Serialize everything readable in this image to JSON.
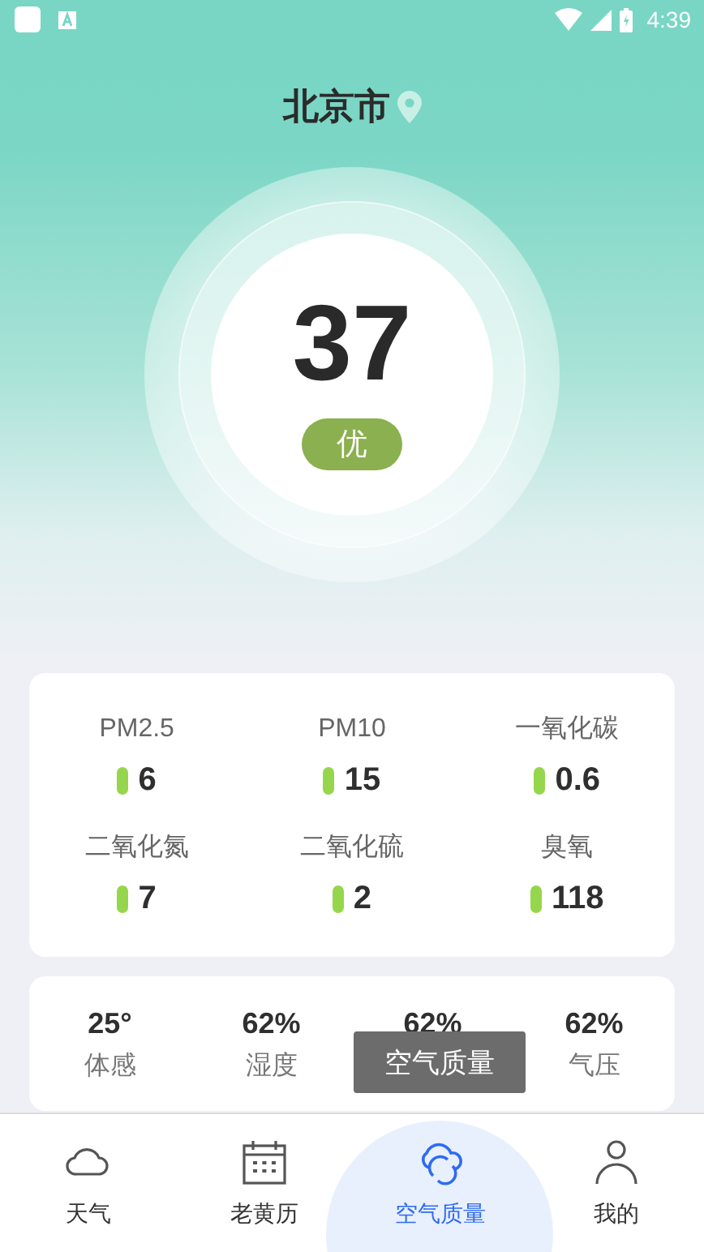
{
  "status_bar": {
    "time": "4:39"
  },
  "city": "北京市",
  "aqi": {
    "value": "37",
    "grade": "优"
  },
  "pollutants": [
    {
      "name": "PM2.5",
      "value": "6"
    },
    {
      "name": "PM10",
      "value": "15"
    },
    {
      "name": "一氧化碳",
      "value": "0.6"
    },
    {
      "name": "二氧化氮",
      "value": "7"
    },
    {
      "name": "二氧化硫",
      "value": "2"
    },
    {
      "name": "臭氧",
      "value": "118"
    }
  ],
  "weather_stats": [
    {
      "value": "25°",
      "label": "体感"
    },
    {
      "value": "62%",
      "label": "湿度"
    },
    {
      "value": "62%"
    },
    {
      "value": "62%",
      "label": "气压"
    }
  ],
  "toast": "空气质量",
  "nav": [
    {
      "kind": "cloud",
      "label": "天气",
      "selected": false
    },
    {
      "kind": "calendar",
      "label": "老黄历",
      "selected": false
    },
    {
      "kind": "air",
      "label": "空气质量",
      "selected": true
    },
    {
      "kind": "person",
      "label": "我的",
      "selected": false
    }
  ]
}
